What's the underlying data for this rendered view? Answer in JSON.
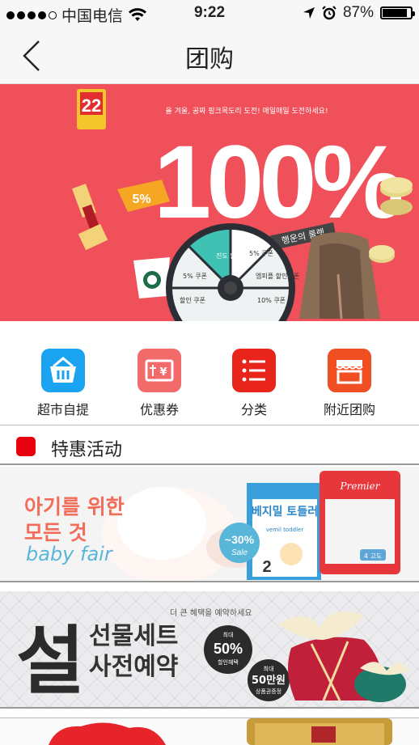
{
  "status_bar": {
    "carrier": "中国电信",
    "time": "9:22",
    "battery": "87%",
    "battery_level": 0.87
  },
  "nav": {
    "back_icon": "chevron-left-icon",
    "title": "团购"
  },
  "banner": {
    "badge": "22",
    "subtitle": "올 겨울, 공짜 핑크목도리 도전! 매일매일 도전하세요!",
    "headline": "100%",
    "tag": "행운의 룰렛",
    "discount": "5%",
    "wheel": [
      "진도 할인쿠폰",
      "5% 쿠폰",
      "엠피플 할인쿠폰",
      "10% 쿠폰",
      "5% 쿠폰",
      "할인 쿠폰"
    ],
    "pager_count": 5,
    "pager_active": 0
  },
  "quick_menu": [
    {
      "label": "超市自提",
      "icon": "basket-icon",
      "color": "#1aa3f0"
    },
    {
      "label": "优惠券",
      "icon": "coupon-icon",
      "color": "#f26a6a"
    },
    {
      "label": "分类",
      "icon": "list-icon",
      "color": "#e8241b"
    },
    {
      "label": "附近团购",
      "icon": "store-icon",
      "color": "#f04e23"
    }
  ],
  "section": {
    "title": "特惠活动"
  },
  "promos": [
    {
      "line1": "아기를 위한",
      "line2": "모든 것",
      "line3": "baby fair",
      "badge": "~30%",
      "badge_sub": "Sale",
      "product": "베지밀 토들러",
      "product_sub": "vemil toddler",
      "product_num": "2",
      "box_brand": "Premier",
      "box_size": "4 고도"
    },
    {
      "calligraphy": "설",
      "top_note": "더 큰 혜택을 예약하세요",
      "line1": "선물세트",
      "line2": "사전예약",
      "badge_small": "최대",
      "badge": "50%",
      "badge_sub": "할인혜택",
      "badge2_small": "최대",
      "badge2": "50만원",
      "badge2_sub": "상품권증정"
    }
  ]
}
